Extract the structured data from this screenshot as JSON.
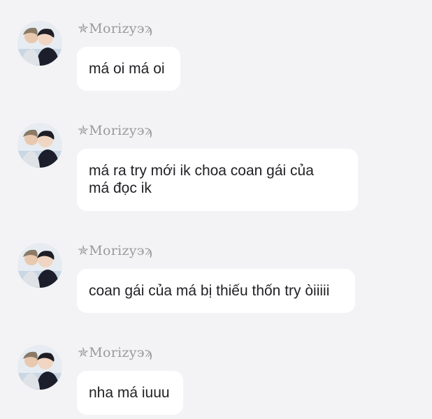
{
  "messages": [
    {
      "sender": "✯Morizy϶ϡ",
      "text": "má oi má oi"
    },
    {
      "sender": "✯Morizy϶ϡ",
      "text": "má ra try mới ik choa coan gái của\nmá đọc ik"
    },
    {
      "sender": "✯Morizy϶ϡ",
      "text": "coan gái của má bị thiếu thốn try òiiiii"
    },
    {
      "sender": "✯Morizy϶ϡ",
      "text": "nha má iuuu"
    }
  ],
  "colors": {
    "background": "#f3f3f5",
    "bubble": "#ffffff",
    "sender_name": "#9a9a9a",
    "message_text": "#222226"
  },
  "icons": {
    "avatar": "profile-photo-avatar"
  }
}
